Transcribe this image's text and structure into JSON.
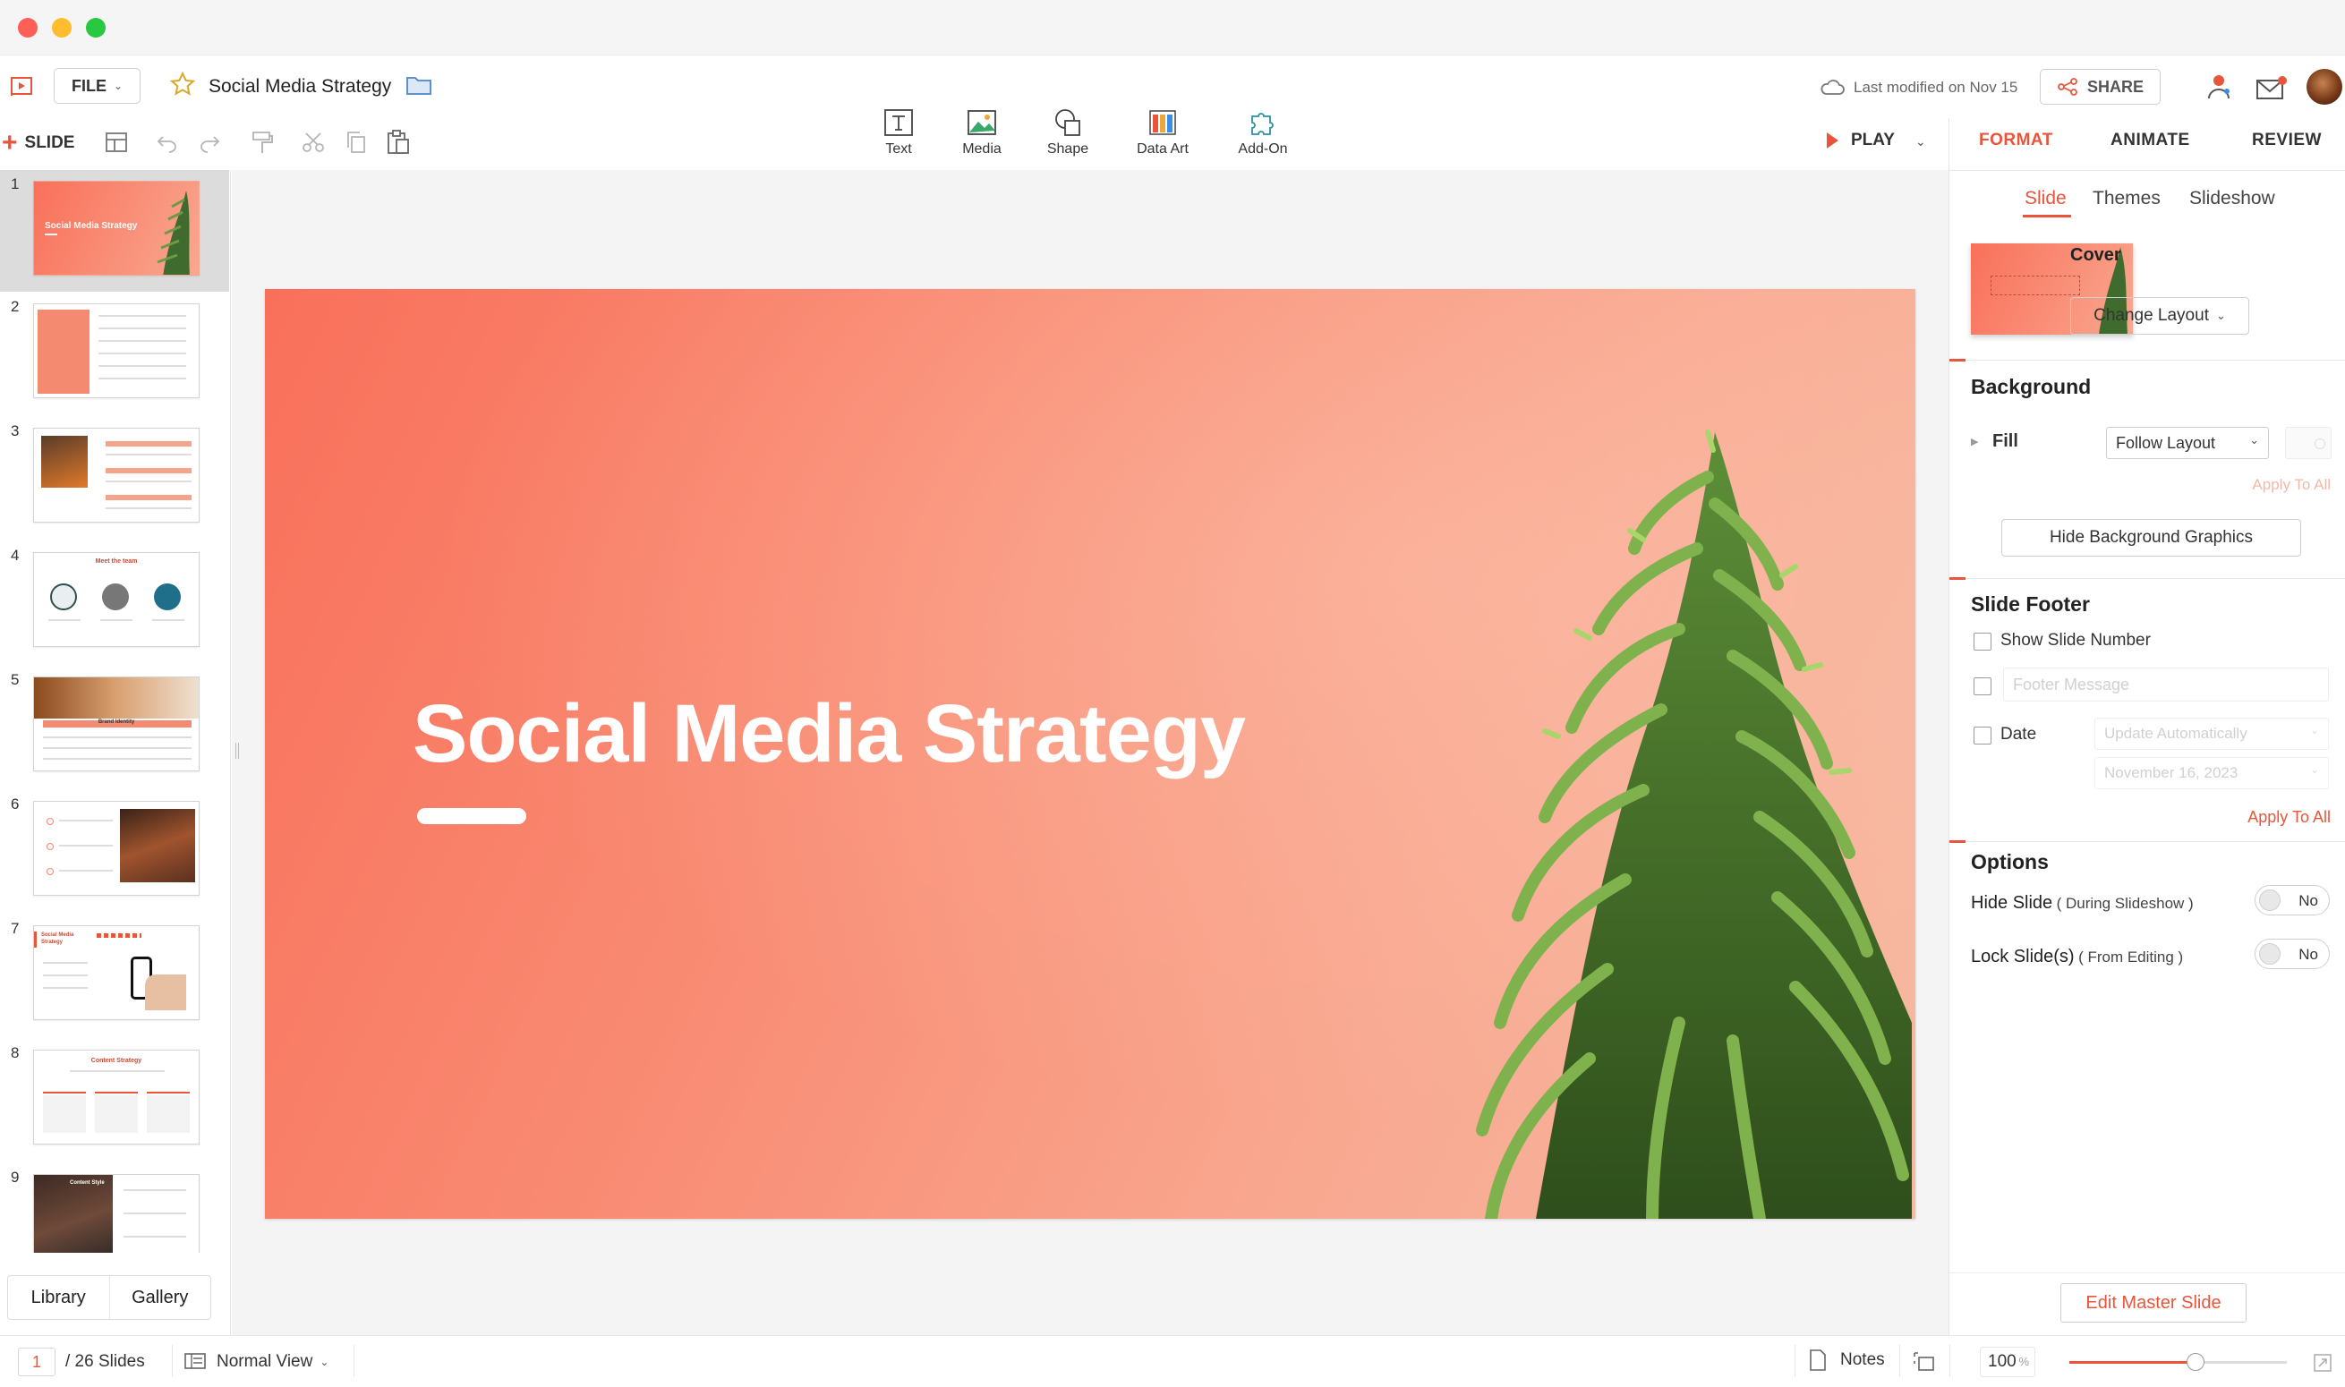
{
  "window": {
    "dots": [
      "#fe5f57",
      "#febc2e",
      "#28c840"
    ]
  },
  "header": {
    "file_label": "FILE",
    "doc_title": "Social Media Strategy",
    "last_modified": "Last modified on Nov 15",
    "share_label": "SHARE"
  },
  "toolbar": {
    "slide_label": "SLIDE",
    "insert": [
      {
        "label": "Text",
        "icon": "text-box-icon"
      },
      {
        "label": "Media",
        "icon": "image-icon"
      },
      {
        "label": "Shape",
        "icon": "shape-icon"
      },
      {
        "label": "Data Art",
        "icon": "chart-icon"
      },
      {
        "label": "Add-On",
        "icon": "puzzle-icon"
      }
    ],
    "play_label": "PLAY"
  },
  "right_tabs": {
    "format": "FORMAT",
    "animate": "ANIMATE",
    "review": "REVIEW"
  },
  "sub_tabs": {
    "slide": "Slide",
    "themes": "Themes",
    "slideshow": "Slideshow"
  },
  "layout": {
    "name": "Cover",
    "change_label": "Change Layout"
  },
  "background": {
    "title": "Background",
    "fill_label": "Fill",
    "fill_value": "Follow Layout",
    "apply_all": "Apply To All",
    "hide_bg_button": "Hide Background Graphics"
  },
  "footer": {
    "title": "Slide Footer",
    "show_number": "Show Slide Number",
    "footer_placeholder": "Footer Message",
    "date_label": "Date",
    "date_mode": "Update Automatically",
    "date_value": "November 16, 2023",
    "apply_all": "Apply To All"
  },
  "options": {
    "title": "Options",
    "hide_slide": "Hide Slide",
    "hide_slide_note": "( During Slideshow )",
    "hide_value": "No",
    "lock_slide": "Lock Slide(s)",
    "lock_slide_note": "( From Editing )",
    "lock_value": "No"
  },
  "master_button": "Edit Master Slide",
  "slides": {
    "numbers": [
      "1",
      "2",
      "3",
      "4",
      "5",
      "6",
      "7",
      "8",
      "9"
    ],
    "thumb1_title": "Social Media Strategy",
    "thumb4_title": "Meet the team",
    "thumb5_title": "Brand Identity",
    "thumb7_title": "Social Media Strategy",
    "thumb8_title": "Content Strategy",
    "thumb9_title": "Content Style"
  },
  "panel_tabs": {
    "library": "Library",
    "gallery": "Gallery"
  },
  "main_slide": {
    "title": "Social Media Strategy"
  },
  "status": {
    "current_page": "1",
    "total": "/ 26 Slides",
    "view": "Normal View",
    "notes": "Notes",
    "zoom": "100",
    "zoom_unit": "%",
    "zoom_level": 0.58
  },
  "colors": {
    "accent": "#e8553a",
    "slide_bg": "#f98a72"
  }
}
